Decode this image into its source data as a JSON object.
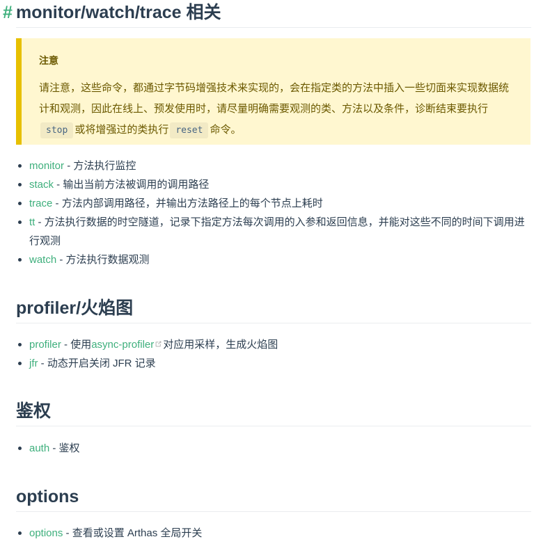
{
  "sections": {
    "monitor": {
      "anchor": "#",
      "title": "monitor/watch/trace 相关",
      "tip": {
        "title": "注意",
        "text_before_stop": "请注意，这些命令，都通过字节码增强技术来实现的，会在指定类的方法中插入一些切面来实现数据统计和观测，因此在线上、预发使用时，请尽量明确需要观测的类、方法以及条件，诊断结束要执行",
        "code_stop": "stop",
        "text_between": "或将增强过的类执行",
        "code_reset": "reset",
        "text_after": "命令。"
      },
      "items": [
        {
          "link": "monitor",
          "desc": " - 方法执行监控"
        },
        {
          "link": "stack",
          "desc": " - 输出当前方法被调用的调用路径"
        },
        {
          "link": "trace",
          "desc": " - 方法内部调用路径，并输出方法路径上的每个节点上耗时"
        },
        {
          "link": "tt",
          "desc": " - 方法执行数据的时空隧道，记录下指定方法每次调用的入参和返回信息，并能对这些不同的时间下调用进行观测"
        },
        {
          "link": "watch",
          "desc": " - 方法执行数据观测"
        }
      ]
    },
    "profiler": {
      "title": "profiler/火焰图",
      "items": [
        {
          "link": "profiler",
          "desc_before": " - 使用",
          "inner_link": "async-profiler",
          "desc_after": "对应用采样，生成火焰图"
        },
        {
          "link": "jfr",
          "desc": " - 动态开启关闭 JFR 记录"
        }
      ]
    },
    "auth": {
      "title": "鉴权",
      "items": [
        {
          "link": "auth",
          "desc": " - 鉴权"
        }
      ]
    },
    "options": {
      "title": "options",
      "items": [
        {
          "link": "options",
          "desc": " - 查看或设置 Arthas 全局开关"
        }
      ]
    }
  },
  "icons": {
    "external": "external-link-icon"
  },
  "colors": {
    "link": "#3eaf7c",
    "text": "#2c3e50",
    "tip_bg": "#fff7d0",
    "tip_border": "#e7c000",
    "tip_text": "#6b5900"
  }
}
